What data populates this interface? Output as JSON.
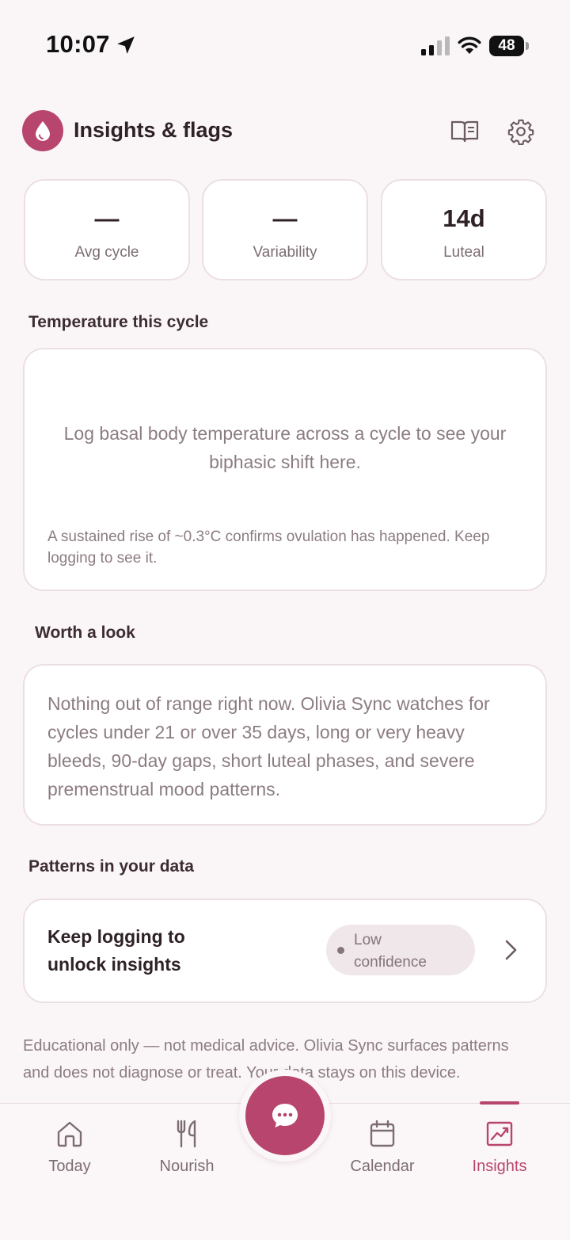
{
  "status_bar": {
    "time": "10:07",
    "battery": "48"
  },
  "header": {
    "title": "Insights & flags"
  },
  "stats": [
    {
      "value": "—",
      "label": "Avg cycle"
    },
    {
      "value": "—",
      "label": "Variability"
    },
    {
      "value": "14d",
      "label": "Luteal"
    }
  ],
  "temperature": {
    "section_title": "Temperature this cycle",
    "empty_message": "Log basal body temperature across a cycle to see your biphasic shift here.",
    "note": "A sustained rise of ~0.3°C confirms ovulation has happened. Keep logging to see it."
  },
  "worth_a_look": {
    "section_title": "Worth a look",
    "text": "Nothing out of range right now. Olivia Sync watches for cycles under 21 or over 35 days, long or very heavy bleeds, 90-day gaps, short luteal phases, and severe premenstrual mood patterns."
  },
  "patterns": {
    "section_title": "Patterns in your data",
    "card_title": "Keep logging to unlock insights",
    "confidence": "Low confidence"
  },
  "disclaimer": "Educational only — not medical advice. Olivia Sync surfaces patterns and does not diagnose or treat. Your data stays on this device.",
  "tabs": [
    {
      "label": "Today",
      "icon": "home-icon"
    },
    {
      "label": "Nourish",
      "icon": "fork-knife-icon"
    },
    {
      "label": "Calendar",
      "icon": "calendar-icon"
    },
    {
      "label": "Insights",
      "icon": "chart-icon",
      "active": true
    }
  ],
  "colors": {
    "accent": "#b8456e",
    "background": "#faf6f7",
    "card": "#ffffff",
    "muted_text": "#8c7c81"
  }
}
